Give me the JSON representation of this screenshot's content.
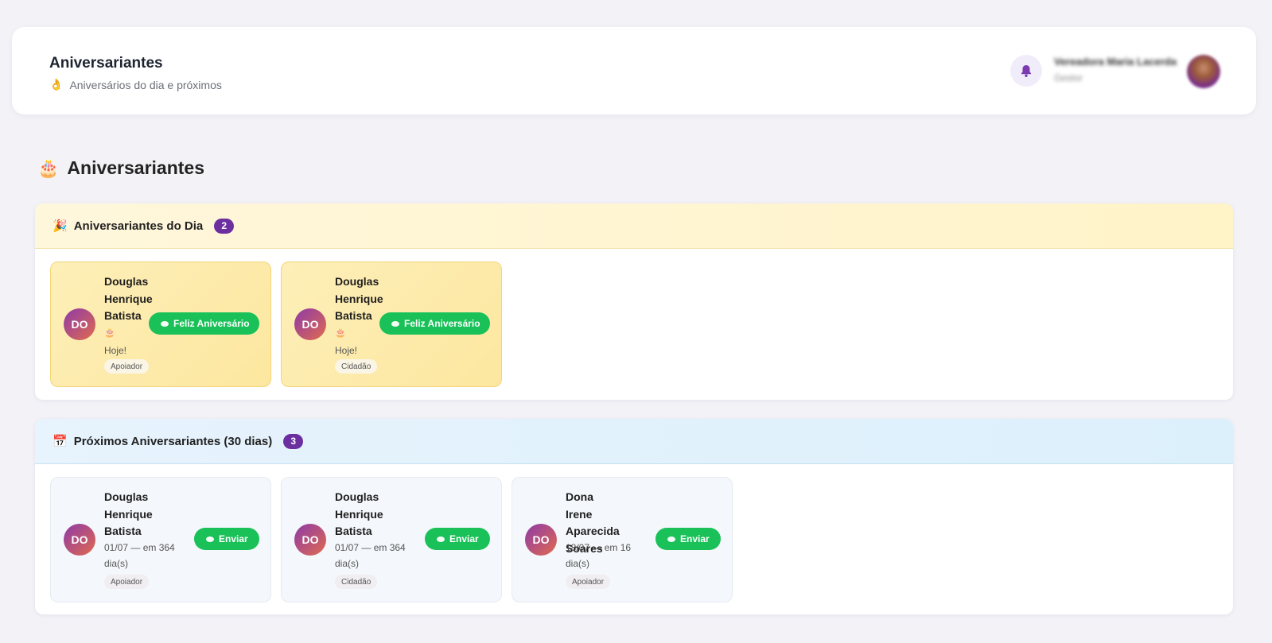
{
  "header": {
    "title": "Aniversariantes",
    "subtitle": "Aniversários do dia e próximos",
    "subtitle_icon": "👌",
    "notification_icon": "bell-icon",
    "user_name": "Vereadora Maria Lacerda",
    "user_role": "Gestor"
  },
  "page": {
    "heading": "Aniversariantes",
    "heading_icon": "🎂"
  },
  "today": {
    "title": "Aniversariantes do Dia",
    "icon": "🎉",
    "count": "2",
    "button_label": "Feliz Aniversário",
    "cards": [
      {
        "initials": "DO",
        "name": "Douglas Henrique Batista",
        "cake": "🎂",
        "when": "Hoje!",
        "tag": "Apoiador"
      },
      {
        "initials": "DO",
        "name": "Douglas Henrique Batista",
        "cake": "🎂",
        "when": "Hoje!",
        "tag": "Cidadão"
      }
    ]
  },
  "upcoming": {
    "title": "Próximos Aniversariantes (30 dias)",
    "icon": "📅",
    "count": "3",
    "button_label": "Enviar",
    "cards": [
      {
        "initials": "DO",
        "name": "Douglas Henrique Batista",
        "when": "01/07 — em 364 dia(s)",
        "tag": "Apoiador"
      },
      {
        "initials": "DO",
        "name": "Douglas Henrique Batista",
        "when": "01/07 — em 364 dia(s)",
        "tag": "Cidadão"
      },
      {
        "initials": "DO",
        "name": "Dona Irene Aparecida Soares",
        "when": "18/07 — em 16 dia(s)",
        "tag": "Apoiador"
      }
    ]
  },
  "colors": {
    "accent_purple": "#6b2fa0",
    "whatsapp_green": "#19c158",
    "today_bg": "#fdefb8",
    "upcoming_header_bg": "#e7f3fd"
  }
}
